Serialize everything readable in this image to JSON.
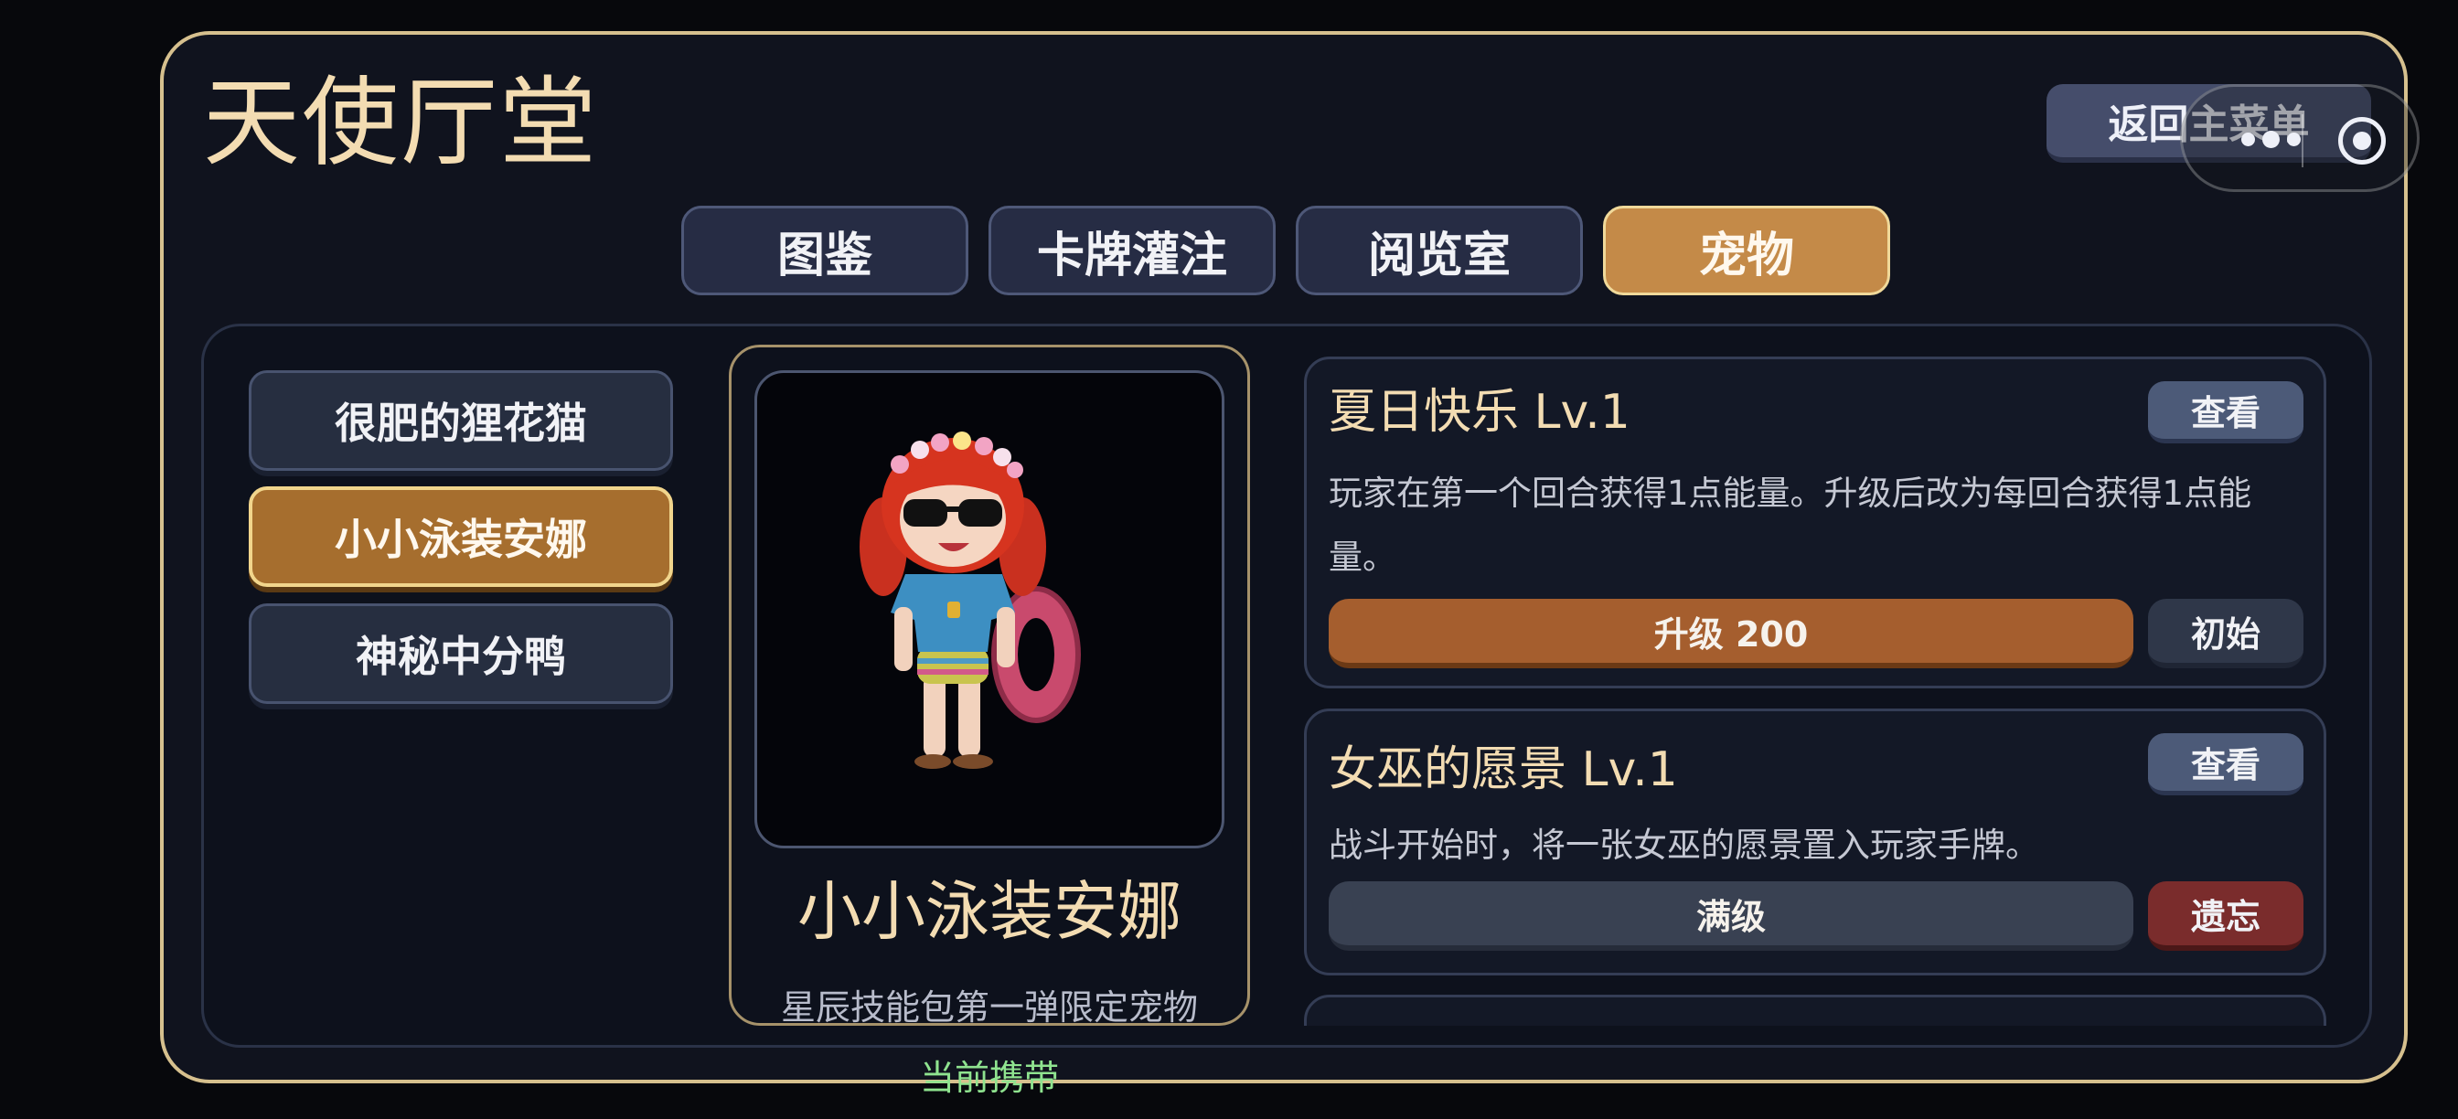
{
  "header": {
    "title": "天使厅堂",
    "back_label": "返回主菜单"
  },
  "tabs": [
    {
      "label": "图鉴",
      "active": false
    },
    {
      "label": "卡牌灌注",
      "active": false
    },
    {
      "label": "阅览室",
      "active": false
    },
    {
      "label": "宠物",
      "active": true
    }
  ],
  "pets": [
    {
      "label": "很肥的狸花猫",
      "active": false
    },
    {
      "label": "小小泳装安娜",
      "active": true
    },
    {
      "label": "神秘中分鸭",
      "active": false
    }
  ],
  "detail": {
    "name": "小小泳装安娜",
    "description": "星辰技能包第一弹限定宠物",
    "status": "当前携带"
  },
  "skills": [
    {
      "title": "夏日快乐 Lv.1",
      "text": "玩家在第一个回合获得1点能量。升级后改为每回合获得1点能量。",
      "view_label": "查看",
      "bar_label": "升级 200",
      "side_label": "初始"
    },
    {
      "title": "女巫的愿景 Lv.1",
      "text": "战斗开始时，将一张女巫的愿景置入玩家手牌。",
      "view_label": "查看",
      "bar_label": "满级",
      "side_label": "遗忘"
    }
  ],
  "colors": {
    "frame_border": "#d6c08e",
    "accent_gold": "#c48a48",
    "title_text": "#f3dcb2",
    "status_green": "#8fe38f",
    "forget_red": "#7a2c2c"
  }
}
